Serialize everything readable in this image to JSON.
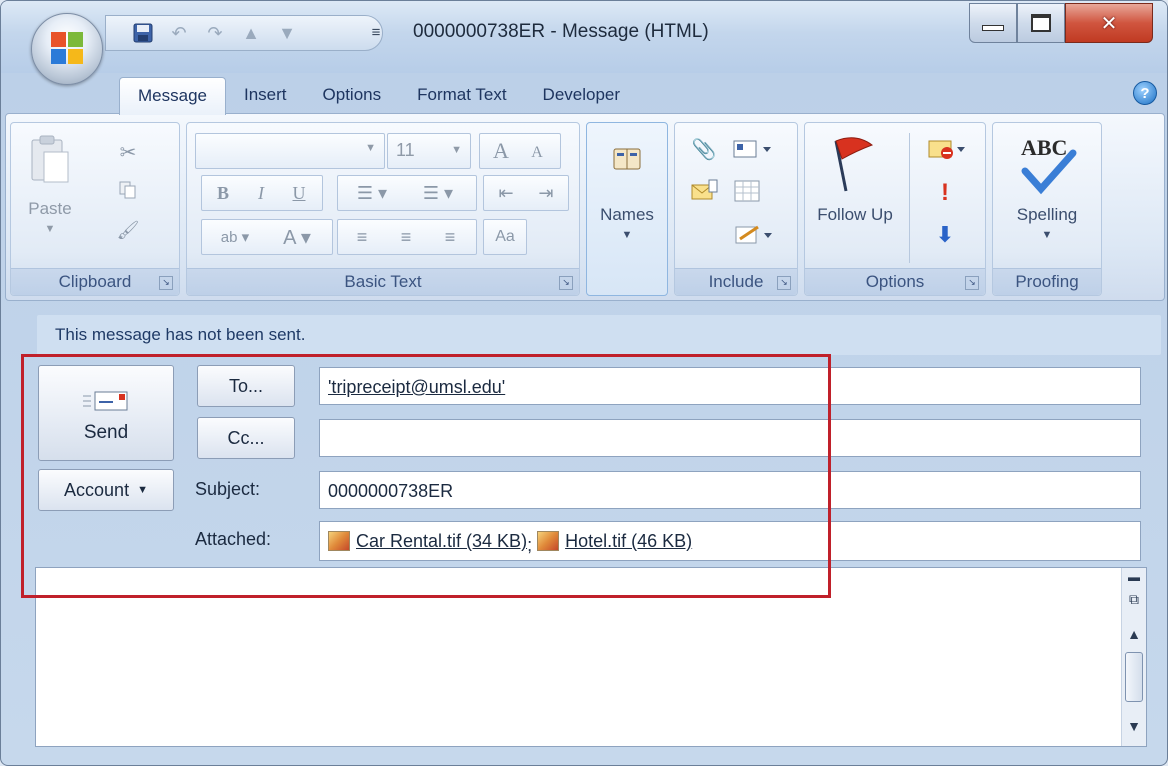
{
  "window": {
    "title": "0000000738ER - Message (HTML)"
  },
  "quick_access": {
    "icons": [
      "save-icon",
      "undo-icon",
      "redo-icon",
      "up-arrow-icon",
      "down-arrow-icon"
    ],
    "more": "≡"
  },
  "tabs": [
    "Message",
    "Insert",
    "Options",
    "Format Text",
    "Developer"
  ],
  "ribbon": {
    "clipboard": {
      "label": "Clipboard",
      "paste": "Paste"
    },
    "basic_text": {
      "label": "Basic Text",
      "font_size": "11"
    },
    "names": {
      "label": "Names"
    },
    "include": {
      "label": "Include"
    },
    "options": {
      "label": "Options",
      "follow_up": "Follow Up"
    },
    "proofing": {
      "label": "Proofing",
      "spelling": "Spelling",
      "abc": "ABC"
    }
  },
  "info_bar": "This message has not been sent.",
  "form": {
    "send_label": "Send",
    "account_label": "Account",
    "to_button": "To...",
    "cc_button": "Cc...",
    "subject_label": "Subject:",
    "attached_label": "Attached:",
    "to_value": "'tripreceipt@umsl.edu'",
    "cc_value": "",
    "subject_value": "0000000738ER",
    "attachments": [
      {
        "name": "Car Rental.tif (34 KB)"
      },
      {
        "name": "Hotel.tif (46 KB)"
      }
    ],
    "attachment_separator": ";"
  },
  "colors": {
    "highlight_box": "#c0202a",
    "accent": "#1f3a66"
  }
}
